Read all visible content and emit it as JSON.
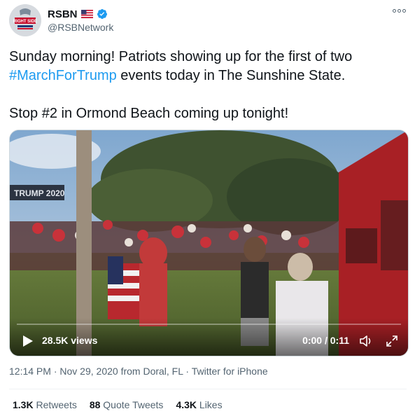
{
  "author": {
    "display_name": "RSBN",
    "handle": "@RSBNetwork",
    "avatar_text": "RIGHT SIDE"
  },
  "tweet": {
    "line1_before": "Sunday morning! Patriots showing up for the first of two ",
    "hashtag": "#MarchForTrump",
    "line1_after": " events today in The Sunshine State.",
    "line2": "Stop #2 in Ormond Beach coming up tonight!"
  },
  "video": {
    "views": "28.5K views",
    "time": "0:00 / 0:11",
    "progress": 0,
    "banner_text": "TRUMP 2020"
  },
  "meta": {
    "time": "12:14 PM",
    "date": "Nov 29, 2020 from Doral, FL",
    "source": "Twitter for iPhone"
  },
  "stats": {
    "retweets_count": "1.3K",
    "retweets_label": "Retweets",
    "quotes_count": "88",
    "quotes_label": "Quote Tweets",
    "likes_count": "4.3K",
    "likes_label": "Likes"
  },
  "colors": {
    "link": "#1d9bf0",
    "verified": "#1d9bf0",
    "text": "#0f1419",
    "secondary": "#536471"
  }
}
